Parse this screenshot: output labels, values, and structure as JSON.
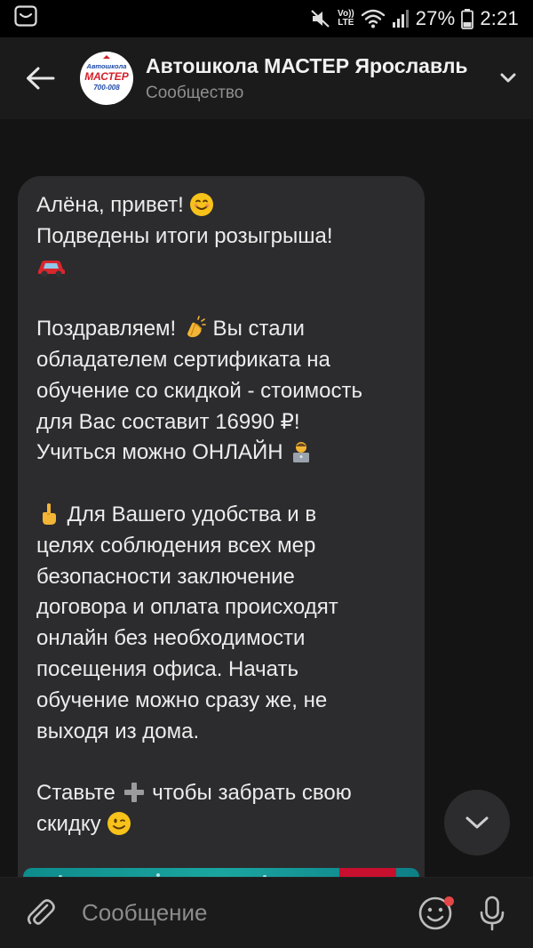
{
  "status_bar": {
    "volte_label": "Vo))",
    "lte_label": "LTE",
    "battery": "27%",
    "time": "2:21",
    "icons": [
      "gallery-icon",
      "mute-icon",
      "wifi-icon",
      "signal-icon",
      "battery-icon"
    ]
  },
  "header": {
    "title": "Автошкола МАСТЕР Ярославль",
    "subtitle": "Сообщество",
    "avatar": {
      "brand_top": "Автошкола",
      "brand_main": "МАСТЕР",
      "brand_phone": "700-008",
      "brand_color": "#d3202a",
      "brand_blue": "#1f4aa8"
    }
  },
  "message": {
    "l1": "Алёна, привет! ",
    "l2": "Подведены итоги розыгрыша!",
    "l3": "Поздравляем! ",
    "l3b": " Вы стали",
    "l4": "обладателем сертификата на",
    "l5": "обучение со скидкой - стоимость",
    "l6": "для Вас составит 16990 ₽!",
    "l7": "Учиться можно ОНЛАЙН ",
    "l8": " Для Вашего удобства и в",
    "l9": "целях соблюдения всех мер",
    "l10": "безопасности заключение",
    "l11": "договора и оплата происходят",
    "l12": "онлайн без необходимости",
    "l13": "посещения офиса. Начать",
    "l14": "обучение можно сразу же, не",
    "l15": "выходя из дома.",
    "l16a": "Ставьте ",
    "l16b": " чтобы забрать свою",
    "l17": "скидку "
  },
  "composer": {
    "placeholder": "Сообщение"
  },
  "colors": {
    "bubble": "#2c2c2e",
    "background": "#141414",
    "header": "#1b1b1b"
  }
}
